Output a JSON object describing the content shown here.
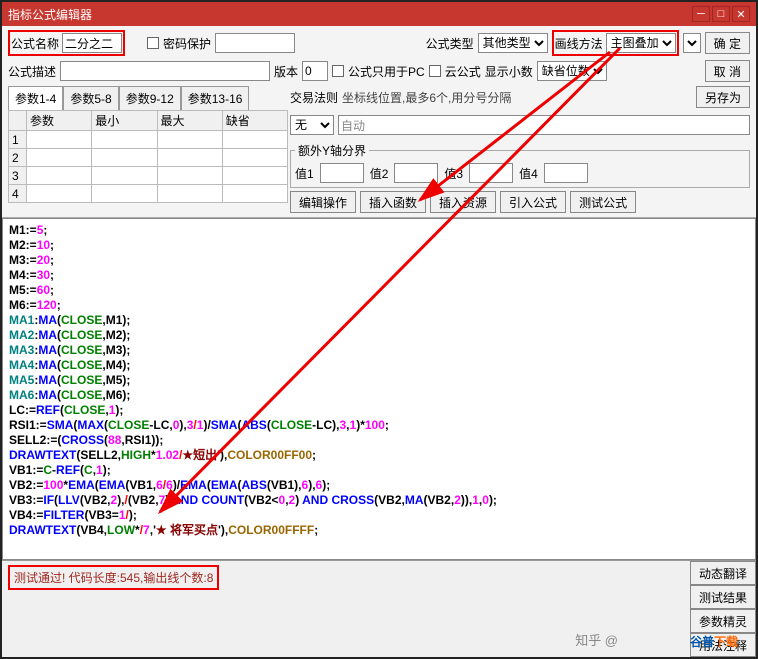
{
  "title": "指标公式编辑器",
  "labels": {
    "name": "公式名称",
    "pwd_protect": "密码保护",
    "formula_type": "公式类型",
    "draw_method": "画线方法",
    "desc": "公式描述",
    "version": "版本",
    "pc_only": "公式只用于PC",
    "cloud": "云公式",
    "decimals": "显示小数",
    "trade_rule": "交易法则",
    "pos_hint": "坐标线位置,最多6个,用分号分隔",
    "y_axis": "额外Y轴分界",
    "val1": "值1",
    "val2": "值2",
    "val3": "值3",
    "val4": "值4",
    "auto": "自动"
  },
  "values": {
    "name": "二分之二",
    "formula_type": "其他类型",
    "draw_method": "主图叠加",
    "version": "0",
    "decimals": "缺省位数",
    "trade_rule": "无"
  },
  "buttons": {
    "ok": "确  定",
    "cancel": "取  消",
    "saveas": "另存为",
    "edit_ops": "编辑操作",
    "insert_fn": "插入函数",
    "insert_res": "插入资源",
    "import_fm": "引入公式",
    "test_fm": "测试公式",
    "dyn_trans": "动态翻译",
    "test_res": "测试结果",
    "param_wiz": "参数精灵",
    "usage_note": "用法注释"
  },
  "tabs": [
    "参数1-4",
    "参数5-8",
    "参数9-12",
    "参数13-16"
  ],
  "param_cols": [
    "参数",
    "最小",
    "最大",
    "缺省"
  ],
  "param_rows": [
    "1",
    "2",
    "3",
    "4"
  ],
  "code_lines": [
    [
      [
        "blk",
        "M1:="
      ],
      [
        "mag",
        "5"
      ],
      [
        "blk",
        ";"
      ]
    ],
    [
      [
        "blk",
        "M2:="
      ],
      [
        "mag",
        "10"
      ],
      [
        "blk",
        ";"
      ]
    ],
    [
      [
        "blk",
        "M3:="
      ],
      [
        "mag",
        "20"
      ],
      [
        "blk",
        ";"
      ]
    ],
    [
      [
        "blk",
        "M4:="
      ],
      [
        "mag",
        "30"
      ],
      [
        "blk",
        ";"
      ]
    ],
    [
      [
        "blk",
        "M5:="
      ],
      [
        "mag",
        "60"
      ],
      [
        "blk",
        ";"
      ]
    ],
    [
      [
        "blk",
        "M6:="
      ],
      [
        "mag",
        "120"
      ],
      [
        "blk",
        ";"
      ]
    ],
    [
      [
        "teal",
        "MA1"
      ],
      [
        "blk",
        ":"
      ],
      [
        "blue",
        "MA"
      ],
      [
        "blk",
        "("
      ],
      [
        "grn",
        "CLOSE"
      ],
      [
        "blk",
        ",M1);"
      ]
    ],
    [
      [
        "teal",
        "MA2"
      ],
      [
        "blk",
        ":"
      ],
      [
        "blue",
        "MA"
      ],
      [
        "blk",
        "("
      ],
      [
        "grn",
        "CLOSE"
      ],
      [
        "blk",
        ",M2);"
      ]
    ],
    [
      [
        "teal",
        "MA3"
      ],
      [
        "blk",
        ":"
      ],
      [
        "blue",
        "MA"
      ],
      [
        "blk",
        "("
      ],
      [
        "grn",
        "CLOSE"
      ],
      [
        "blk",
        ",M3);"
      ]
    ],
    [
      [
        "teal",
        "MA4"
      ],
      [
        "blk",
        ":"
      ],
      [
        "blue",
        "MA"
      ],
      [
        "blk",
        "("
      ],
      [
        "grn",
        "CLOSE"
      ],
      [
        "blk",
        ",M4);"
      ]
    ],
    [
      [
        "teal",
        "MA5"
      ],
      [
        "blk",
        ":"
      ],
      [
        "blue",
        "MA"
      ],
      [
        "blk",
        "("
      ],
      [
        "grn",
        "CLOSE"
      ],
      [
        "blk",
        ",M5);"
      ]
    ],
    [
      [
        "teal",
        "MA6"
      ],
      [
        "blk",
        ":"
      ],
      [
        "blue",
        "MA"
      ],
      [
        "blk",
        "("
      ],
      [
        "grn",
        "CLOSE"
      ],
      [
        "blk",
        ",M6);"
      ]
    ],
    [
      [
        "blk",
        "LC:="
      ],
      [
        "blue",
        "REF"
      ],
      [
        "blk",
        "("
      ],
      [
        "grn",
        "CLOSE"
      ],
      [
        "blk",
        ","
      ],
      [
        "mag",
        "1"
      ],
      [
        "blk",
        ");"
      ]
    ],
    [
      [
        "blk",
        "RSI1:="
      ],
      [
        "blue",
        "SMA"
      ],
      [
        "blk",
        "("
      ],
      [
        "blue",
        "MAX"
      ],
      [
        "blk",
        "("
      ],
      [
        "grn",
        "CLOSE"
      ],
      [
        "blk",
        "-LC,"
      ],
      [
        "mag",
        "0"
      ],
      [
        "blk",
        "),"
      ],
      [
        "mag",
        "3"
      ],
      [
        "red",
        "/"
      ],
      [
        "mag",
        "1"
      ],
      [
        "blk",
        ")/"
      ],
      [
        "blue",
        "SMA"
      ],
      [
        "blk",
        "("
      ],
      [
        "blue",
        "ABS"
      ],
      [
        "blk",
        "("
      ],
      [
        "grn",
        "CLOSE"
      ],
      [
        "blk",
        "-LC),"
      ],
      [
        "mag",
        "3"
      ],
      [
        "blk",
        ","
      ],
      [
        "mag",
        "1"
      ],
      [
        "blk",
        ")*"
      ],
      [
        "mag",
        "100"
      ],
      [
        "blk",
        ";"
      ]
    ],
    [
      [
        "blk",
        "SELL2:=("
      ],
      [
        "blue",
        "CROSS"
      ],
      [
        "blk",
        "("
      ],
      [
        "mag",
        "88"
      ],
      [
        "blk",
        ",RSI1));"
      ]
    ],
    [
      [
        "blue",
        "DRAWTEXT"
      ],
      [
        "blk",
        "(SELL2,"
      ],
      [
        "grn",
        "HIGH"
      ],
      [
        "blk",
        "*"
      ],
      [
        "mag",
        "1.02"
      ],
      [
        "red",
        "/"
      ],
      [
        "dkred",
        "★短出"
      ],
      [
        "blk",
        "'),"
      ],
      [
        "brn",
        "COLOR00FF00"
      ],
      [
        "blk",
        ";"
      ]
    ],
    [
      [
        "blk",
        "VB1:="
      ],
      [
        "grn",
        "C"
      ],
      [
        "blk",
        "-"
      ],
      [
        "blue",
        "REF"
      ],
      [
        "blk",
        "("
      ],
      [
        "grn",
        "C"
      ],
      [
        "blk",
        ","
      ],
      [
        "mag",
        "1"
      ],
      [
        "blk",
        ");"
      ]
    ],
    [
      [
        "blk",
        "VB2:="
      ],
      [
        "mag",
        "100"
      ],
      [
        "blk",
        "*"
      ],
      [
        "blue",
        "EMA"
      ],
      [
        "blk",
        "("
      ],
      [
        "blue",
        "EMA"
      ],
      [
        "blk",
        "(VB1,"
      ],
      [
        "mag",
        "6"
      ],
      [
        "red",
        "/"
      ],
      [
        "mag",
        "6"
      ],
      [
        "blk",
        ")/"
      ],
      [
        "blue",
        "EMA"
      ],
      [
        "blk",
        "("
      ],
      [
        "blue",
        "EMA"
      ],
      [
        "blk",
        "("
      ],
      [
        "blue",
        "ABS"
      ],
      [
        "blk",
        "(VB1),"
      ],
      [
        "mag",
        "6"
      ],
      [
        "blk",
        "),"
      ],
      [
        "mag",
        "6"
      ],
      [
        "blk",
        ");"
      ]
    ],
    [
      [
        "blk",
        "VB3:="
      ],
      [
        "blue",
        "IF"
      ],
      [
        "blk",
        "("
      ],
      [
        "blue",
        "LLV"
      ],
      [
        "blk",
        "(VB2,"
      ],
      [
        "mag",
        "2"
      ],
      [
        "blk",
        "),"
      ],
      [
        "red",
        "/"
      ],
      [
        "blk",
        "(VB2,"
      ],
      [
        "mag",
        "7"
      ],
      [
        "blk",
        ") "
      ],
      [
        "blue",
        "AND"
      ],
      [
        "blk",
        " "
      ],
      [
        "blue",
        "COUNT"
      ],
      [
        "blk",
        "(VB2<"
      ],
      [
        "mag",
        "0"
      ],
      [
        "blk",
        ","
      ],
      [
        "mag",
        "2"
      ],
      [
        "blk",
        ") "
      ],
      [
        "blue",
        "AND"
      ],
      [
        "blk",
        " "
      ],
      [
        "blue",
        "CROSS"
      ],
      [
        "blk",
        "(VB2,"
      ],
      [
        "blue",
        "MA"
      ],
      [
        "blk",
        "(VB2,"
      ],
      [
        "mag",
        "2"
      ],
      [
        "blk",
        ")),"
      ],
      [
        "mag",
        "1"
      ],
      [
        "blk",
        ","
      ],
      [
        "mag",
        "0"
      ],
      [
        "blk",
        ");"
      ]
    ],
    [
      [
        "blk",
        "VB4:="
      ],
      [
        "blue",
        "FILTER"
      ],
      [
        "blk",
        "(VB3="
      ],
      [
        "mag",
        "1"
      ],
      [
        "red",
        "/"
      ],
      [
        "blk",
        ");"
      ]
    ],
    [
      [
        "blue",
        "DRAWTEXT"
      ],
      [
        "blk",
        "(VB4,"
      ],
      [
        "grn",
        "LOW"
      ],
      [
        "blk",
        "*"
      ],
      [
        "red",
        "/"
      ],
      [
        "mag",
        "7"
      ],
      [
        "blk",
        ",'"
      ],
      [
        "dkred",
        "★ 将军买点"
      ],
      [
        "blk",
        "'),"
      ],
      [
        "brn",
        "COLOR00FFFF"
      ],
      [
        "blk",
        ";"
      ]
    ]
  ],
  "status": "测试通过! 代码长度:545,输出线个数:8",
  "watermark": {
    "a": "谷普",
    "b": "下载"
  },
  "wm2": "知乎 @"
}
